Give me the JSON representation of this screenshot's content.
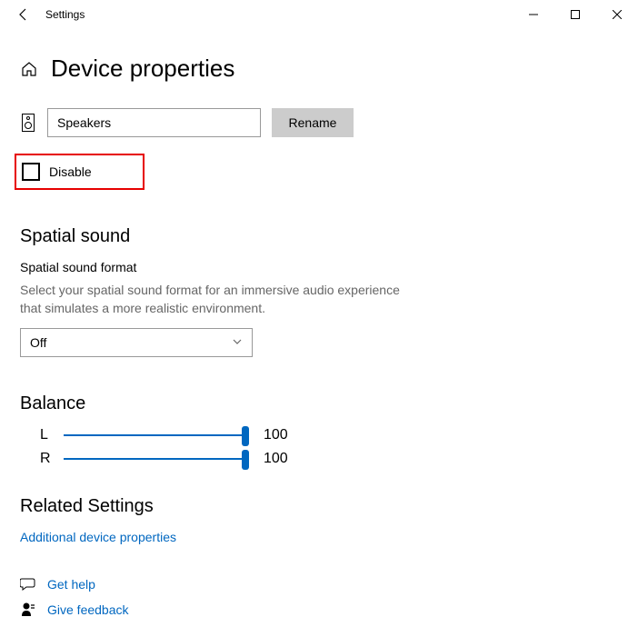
{
  "window": {
    "title": "Settings"
  },
  "page": {
    "title": "Device properties"
  },
  "device": {
    "name": "Speakers",
    "rename_label": "Rename",
    "disable_label": "Disable",
    "disable_checked": false
  },
  "spatial": {
    "heading": "Spatial sound",
    "format_label": "Spatial sound format",
    "description": "Select your spatial sound format for an immersive audio experience that simulates a more realistic environment.",
    "selected": "Off"
  },
  "balance": {
    "heading": "Balance",
    "left_label": "L",
    "left_value": "100",
    "right_label": "R",
    "right_value": "100"
  },
  "related": {
    "heading": "Related Settings",
    "link": "Additional device properties"
  },
  "footer": {
    "help": "Get help",
    "feedback": "Give feedback"
  }
}
